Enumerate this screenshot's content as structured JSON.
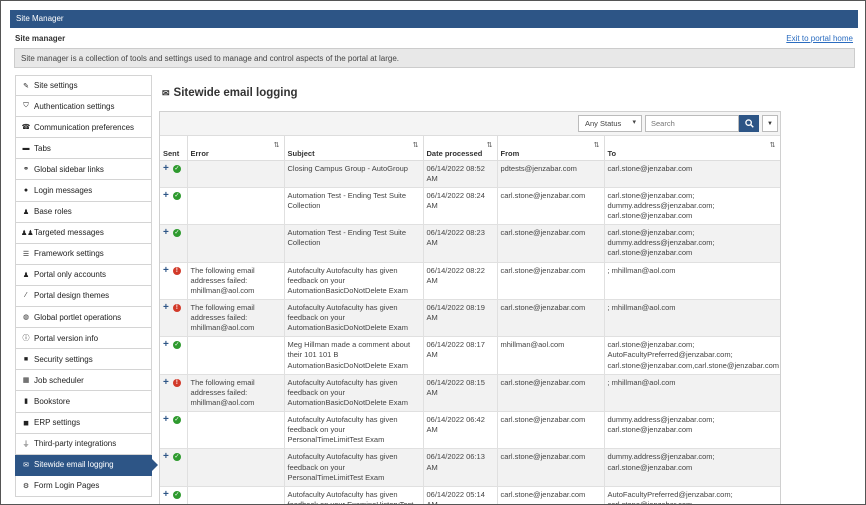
{
  "header": {
    "title": "Site Manager"
  },
  "page": {
    "heading": "Site manager",
    "exit_link": "Exit to portal home",
    "description": "Site manager is a collection of tools and settings used to manage and control aspects of the portal at large."
  },
  "sidebar": {
    "items": [
      {
        "label": "Site settings",
        "icon": "wrench-icon",
        "glyph": "✎"
      },
      {
        "label": "Authentication settings",
        "icon": "shield-icon",
        "glyph": "⛉"
      },
      {
        "label": "Communication preferences",
        "icon": "phone-icon",
        "glyph": "☎"
      },
      {
        "label": "Tabs",
        "icon": "folder-icon",
        "glyph": "▬"
      },
      {
        "label": "Global sidebar links",
        "icon": "link-icon",
        "glyph": "⚭"
      },
      {
        "label": "Login messages",
        "icon": "comment-icon",
        "glyph": "●"
      },
      {
        "label": "Base roles",
        "icon": "user-icon",
        "glyph": "♟"
      },
      {
        "label": "Targeted messages",
        "icon": "users-icon",
        "glyph": "♟♟"
      },
      {
        "label": "Framework settings",
        "icon": "sliders-icon",
        "glyph": "☰"
      },
      {
        "label": "Portal only accounts",
        "icon": "user-plus-icon",
        "glyph": "♟"
      },
      {
        "label": "Portal design themes",
        "icon": "brush-icon",
        "glyph": "⁄"
      },
      {
        "label": "Global portlet operations",
        "icon": "globe-icon",
        "glyph": "◍"
      },
      {
        "label": "Portal version info",
        "icon": "info-icon",
        "glyph": "ⓘ"
      },
      {
        "label": "Security settings",
        "icon": "lock-icon",
        "glyph": "■"
      },
      {
        "label": "Job scheduler",
        "icon": "calendar-icon",
        "glyph": "▦"
      },
      {
        "label": "Bookstore",
        "icon": "book-icon",
        "glyph": "▮"
      },
      {
        "label": "ERP settings",
        "icon": "cube-icon",
        "glyph": "◼"
      },
      {
        "label": "Third-party integrations",
        "icon": "plug-icon",
        "glyph": "⏚"
      },
      {
        "label": "Sitewide email logging",
        "icon": "envelope-icon",
        "glyph": "✉"
      },
      {
        "label": "Form Login Pages",
        "icon": "gears-icon",
        "glyph": "⚙"
      }
    ],
    "active_index": 18
  },
  "main": {
    "title": "Sitewide email logging",
    "title_icon": "envelope-icon"
  },
  "toolbar": {
    "status_value": "Any Status",
    "search_placeholder": "Search"
  },
  "table": {
    "columns": [
      "Sent",
      "Error",
      "Subject",
      "Date processed",
      "From",
      "To"
    ],
    "rows": [
      {
        "status": "ok",
        "error": "",
        "subject": "Closing Campus Group - AutoGroup",
        "date": "06/14/2022 08:52 AM",
        "from": "pdtests@jenzabar.com",
        "to": "carl.stone@jenzabar.com"
      },
      {
        "status": "ok",
        "error": "",
        "subject": "Automation Test - Ending Test Suite Collection",
        "date": "06/14/2022 08:24 AM",
        "from": "carl.stone@jenzabar.com",
        "to": "carl.stone@jenzabar.com; dummy.address@jenzabar.com; carl.stone@jenzabar.com"
      },
      {
        "status": "ok",
        "error": "",
        "subject": "Automation Test - Ending Test Suite Collection",
        "date": "06/14/2022 08:23 AM",
        "from": "carl.stone@jenzabar.com",
        "to": "carl.stone@jenzabar.com; dummy.address@jenzabar.com; carl.stone@jenzabar.com"
      },
      {
        "status": "err",
        "error": "The following email addresses failed: mhillman@aol.com",
        "subject": "Autofaculty Autofaculty has given feedback on your AutomationBasicDoNotDelete Exam",
        "date": "06/14/2022 08:22 AM",
        "from": "carl.stone@jenzabar.com",
        "to": "; mhillman@aol.com"
      },
      {
        "status": "err",
        "error": "The following email addresses failed: mhillman@aol.com",
        "subject": "Autofaculty Autofaculty has given feedback on your AutomationBasicDoNotDelete Exam",
        "date": "06/14/2022 08:19 AM",
        "from": "carl.stone@jenzabar.com",
        "to": "; mhillman@aol.com"
      },
      {
        "status": "ok",
        "error": "",
        "subject": "Meg Hillman made a comment about their 101 101 B AutomationBasicDoNotDelete Exam",
        "date": "06/14/2022 08:17 AM",
        "from": "mhillman@aol.com",
        "to": "carl.stone@jenzabar.com; AutoFacultyPreferred@jenzabar.com; carl.stone@jenzabar.com,carl.stone@jenzabar.com"
      },
      {
        "status": "err",
        "error": "The following email addresses failed: mhillman@aol.com",
        "subject": "Autofaculty Autofaculty has given feedback on your AutomationBasicDoNotDelete Exam",
        "date": "06/14/2022 08:15 AM",
        "from": "carl.stone@jenzabar.com",
        "to": "; mhillman@aol.com"
      },
      {
        "status": "ok",
        "error": "",
        "subject": "Autofaculty Autofaculty has given feedback on your PersonalTimeLimitTest Exam",
        "date": "06/14/2022 06:42 AM",
        "from": "carl.stone@jenzabar.com",
        "to": "dummy.address@jenzabar.com; carl.stone@jenzabar.com"
      },
      {
        "status": "ok",
        "error": "",
        "subject": "Autofaculty Autofaculty has given feedback on your PersonalTimeLimitTest Exam",
        "date": "06/14/2022 06:13 AM",
        "from": "carl.stone@jenzabar.com",
        "to": "dummy.address@jenzabar.com; carl.stone@jenzabar.com"
      },
      {
        "status": "ok",
        "error": "",
        "subject": "Autofaculty Autofaculty has given feedback on your ExamineHistoryTest",
        "date": "06/14/2022 05:14 AM",
        "from": "carl.stone@jenzabar.com",
        "to": "AutoFacultyPreferred@jenzabar.com; carl.stone@jenzabar.com"
      }
    ]
  },
  "colors": {
    "accent": "#2d5586",
    "success": "#2e9a2e",
    "error": "#d23a2a",
    "link": "#2a6cc0"
  }
}
